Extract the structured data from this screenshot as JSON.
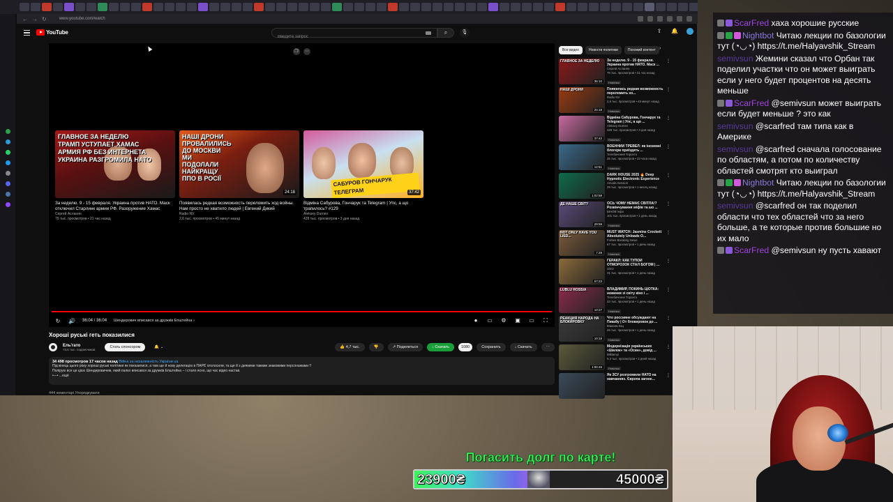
{
  "browser": {
    "url": "www.youtube.com/watch",
    "nav_back": "←",
    "nav_forward": "→",
    "nav_reload": "↻"
  },
  "youtube": {
    "logo_text": "YouTube",
    "search_placeholder": "Введите запрос",
    "search_icon": "⌕",
    "mic_icon": "🎙",
    "upload_icon": "⇪",
    "bell_icon": "🔔"
  },
  "endscreen": [
    {
      "headline": "ГЛАВНОЕ ЗА НЕДЕЛЮ\nТРАМП УСТУПАЕТ ХАМАС\nАРМИЯ РФ БЕЗ ИНТЕРНЕТА\nУКРАИНА РАЗГРОМИЛА НАТО",
      "duration": "",
      "title": "За неделю. 9 - 15 февраля. Украина против НАТО. Маск отключил Старлинк армии РФ. Разоружение Хамас",
      "channel": "Сергей Асланян",
      "meta": "79 тыс. просмотров • 21 час назад"
    },
    {
      "headline": "НАШІ ДРОНИ ПРОВАЛИЛИСЬ ДО МОСКВИ\nМИ ПОДОЛАЛИ НАЙКРАЩУ ППО В РОСІЇ",
      "duration": "24:18",
      "title": "Появилась редкая возможность переломить ход войны. Нам просто не хватило людей | Евгений Дикий",
      "channel": "Radio NV",
      "meta": "2,6 тыс. просмотров • 45 минут назад"
    },
    {
      "headline": "САБУРОВ ГОНЧАРУК ТЕЛЕГРАМ",
      "duration": "37:42",
      "title": "Відміна Сабурова, Гончарук та Telegram | Упс, а що трапилось? #129",
      "channel": "Aleksey Durnev",
      "meta": "428 тыс. просмотров • 3 дня назад"
    }
  ],
  "player": {
    "time": "36:04 / 36:04",
    "chapter": "Шендерович вписався за дружків Епштейна ›",
    "replay_icon": "↻",
    "volume_icon": "🔊"
  },
  "video": {
    "title": "Хороші руські геть показилися",
    "channel_name": "Ель'гато",
    "channel_subs": "73,6 тыс. подписчиков",
    "sponsor_label": "Стать спонсором",
    "bell": "🔔 ⌄",
    "likes": "👍 4,7 тыс.",
    "dislike": "👎",
    "share": "↗ Поделиться",
    "download_green": "↓ Скачать",
    "download_count": "1080",
    "save": "Сохранить",
    "download": "↓ Скачать",
    "more": "⋯",
    "desc_meta": "34 498 просмотров  17 часов назад",
    "desc_tag": "Війна за незалежність України ua",
    "desc_line1": "Під кінець цього року хороші руські політики як показилися, а там ще й нову делегацію в ПАРЄ оголосили, та ще й з деякими такими знаковими персонажами !!",
    "desc_line2": "Полірую все це цією Шендеровичем, який палко вписався за дружків Епштейна – і стало ясно, що час відео настав.",
    "desc_more": "•—• ...ещё",
    "comments_cut": "444 коментарі     Упорядкувати"
  },
  "sidebar": {
    "chips": [
      "Все видео",
      "Новости политики",
      "Похожий контент"
    ],
    "items": [
      {
        "cap": "ГЛАВНОЕ ЗА НЕДЕЛЮ",
        "dur": "36:10",
        "title": "За неделю. 9 - 15 февраля. Украина против НАТО. Маск ...",
        "channel": "Сергей Асланян",
        "meta": "79 тыс. просмотров • 21 час назад",
        "badge": "Новинка",
        "color": "#8a1818"
      },
      {
        "cap": "НАШІ ДРОНИ",
        "dur": "24:18",
        "title": "Появилась редкая возможность переломить хо...",
        "channel": "Radio NV",
        "meta": "2,6 тыс. просмотров • 45 минут назад",
        "badge": "Новинка",
        "color": "#9a3a10"
      },
      {
        "cap": "",
        "dur": "37:42",
        "title": "Відміна Сабурова, Гончарук та Telegram | Упс, а що ...",
        "channel": "Aleksey Durnev",
        "meta": "428 тыс. просмотров • 3 дня назад",
        "badge": "Новинка",
        "color": "#c86aa0"
      },
      {
        "cap": "",
        "dur": "12:51",
        "title": "ВОЕННИЙ ТРЕВЕЛ: як іноземні блогери приїздять ...",
        "channel": "Телебачення Торонто",
        "meta": "25 тыс. просмотров • 23 часа назад",
        "badge": "Новинка",
        "color": "#3a6a8a"
      },
      {
        "cap": "",
        "dur": "1:02:58",
        "title": "DARK HOUSE 2025 🔥 Deep Hypnotic Electronic Experience",
        "channel": "Amoda Session",
        "meta": "29 тыс. просмотров • 1 месяц назад",
        "badge": "",
        "color": "#0e6a4a"
      },
      {
        "cap": "ДЕ НАШЕ СВІТ?",
        "dur": "29:59",
        "title": "ОСЬ ЧОМУ НЕМАЄ СВІТЛА!? Розвінчування міфів та шо ...",
        "channel": "БІНОВ Інфо",
        "meta": "101 тыс. просмотров • 1 день назад",
        "badge": "Новинка",
        "color": "#5a4a7a"
      },
      {
        "cap": "NOT ONLY HAVE YOU LIED...",
        "dur": "7:28",
        "title": "MUST WATCH: Jasmine Crockett Absolutely Unloads O...",
        "channel": "Forbes Breaking News",
        "meta": "67 тыс. просмотров • 1 день назад",
        "badge": "Новинка",
        "color": "#7a5a3a"
      },
      {
        "cap": "",
        "dur": "57:23",
        "title": "ГЕРАКЛ: КАК ТУПОЙ ОТМОРОЗОК СТАЛ БОГОМ | ...",
        "channel": "GEO",
        "meta": "31 тыс. просмотров • 1 день назад",
        "badge": "",
        "color": "#8a6a3a"
      },
      {
        "cap": "LUBLU ROSSIA",
        "dur": "10:27",
        "title": "ВЛАДИМИР, ПОКИНЬ ЦІОТКА: новинки зі світу кіно і ...",
        "channel": "Телебачення Торонто",
        "meta": "23 тыс. просмотров • 1 день назад",
        "badge": "Новинка",
        "color": "#8a2a4a"
      },
      {
        "cap": "Реакция народа на блокировку",
        "dur": "10:18",
        "title": "Что россияне обсуждают на Пикабу | От блокировок до ...",
        "channel": "Максим Кац",
        "meta": "29 тыс. просмотров • 1 день назад",
        "badge": "Новинка",
        "color": "#3a3a3a"
      },
      {
        "cap": "",
        "dur": "1:00:46",
        "title": "Модернізація українських «Шилок» та «Осин», довід ...",
        "channel": "Militarnyi",
        "meta": "9,3 тыс. просмотров • 3 дней назад",
        "badge": "Новинка",
        "color": "#5a5a3a"
      },
      {
        "cap": "",
        "dur": "",
        "title": "Як ЗСУ розгромили НАТО на навчаннях. Європа загене...",
        "channel": "",
        "meta": "",
        "badge": "",
        "color": "#3a4a5a"
      }
    ]
  },
  "chat": [
    {
      "user": "ScarFred",
      "class": "user-scarfred",
      "badges": [
        "gray",
        "sub"
      ],
      "text": "хаха хорошие русские"
    },
    {
      "user": "Nightbot",
      "class": "user-nightbot",
      "badges": [
        "gray",
        "mod",
        "vip"
      ],
      "text": "Читаю лекции по базологии тут (◔◡◔) https://t.me/Halyavshik_Stream"
    },
    {
      "user": "semivsun",
      "class": "user-semivsun",
      "badges": [],
      "text": "Жемини сказал что Орбан так поделил участки что он может выиграть если у него будет процентов на десять меньше"
    },
    {
      "user": "ScarFred",
      "class": "user-scarfred",
      "badges": [
        "gray",
        "sub"
      ],
      "text": "@semivsun может выиграть если будет меньше ? это как"
    },
    {
      "user": "semivsun",
      "class": "user-semivsun",
      "badges": [],
      "text": "@scarfred там типа как в Америке"
    },
    {
      "user": "semivsun",
      "class": "user-semivsun",
      "badges": [],
      "text": "@scarfred сначала голосование по областям, а потом по количеству областей смотрят кто выиграл"
    },
    {
      "user": "Nightbot",
      "class": "user-nightbot",
      "badges": [
        "gray",
        "mod",
        "vip"
      ],
      "text": "Читаю лекции по базологии тут (◔◡◔) https://t.me/Halyavshik_Stream"
    },
    {
      "user": "semivsun",
      "class": "user-semivsun",
      "badges": [],
      "text": "@scarfred он так поделил области что тех областей что за него больше, а те которые против большие но их мало"
    },
    {
      "user": "ScarFred",
      "class": "user-scarfred",
      "badges": [
        "gray",
        "sub"
      ],
      "text": "@semivsun ну пусть хавают"
    }
  ],
  "donation": {
    "title": "Погасить долг по карте!",
    "current": "23900₴",
    "target": "45000₴",
    "progress": 0.531
  },
  "colors": {
    "accent_red": "#ff0000",
    "goal_green": "#3ef25a",
    "scarfred": "#a044e0",
    "nightbot": "#8a7adb"
  }
}
